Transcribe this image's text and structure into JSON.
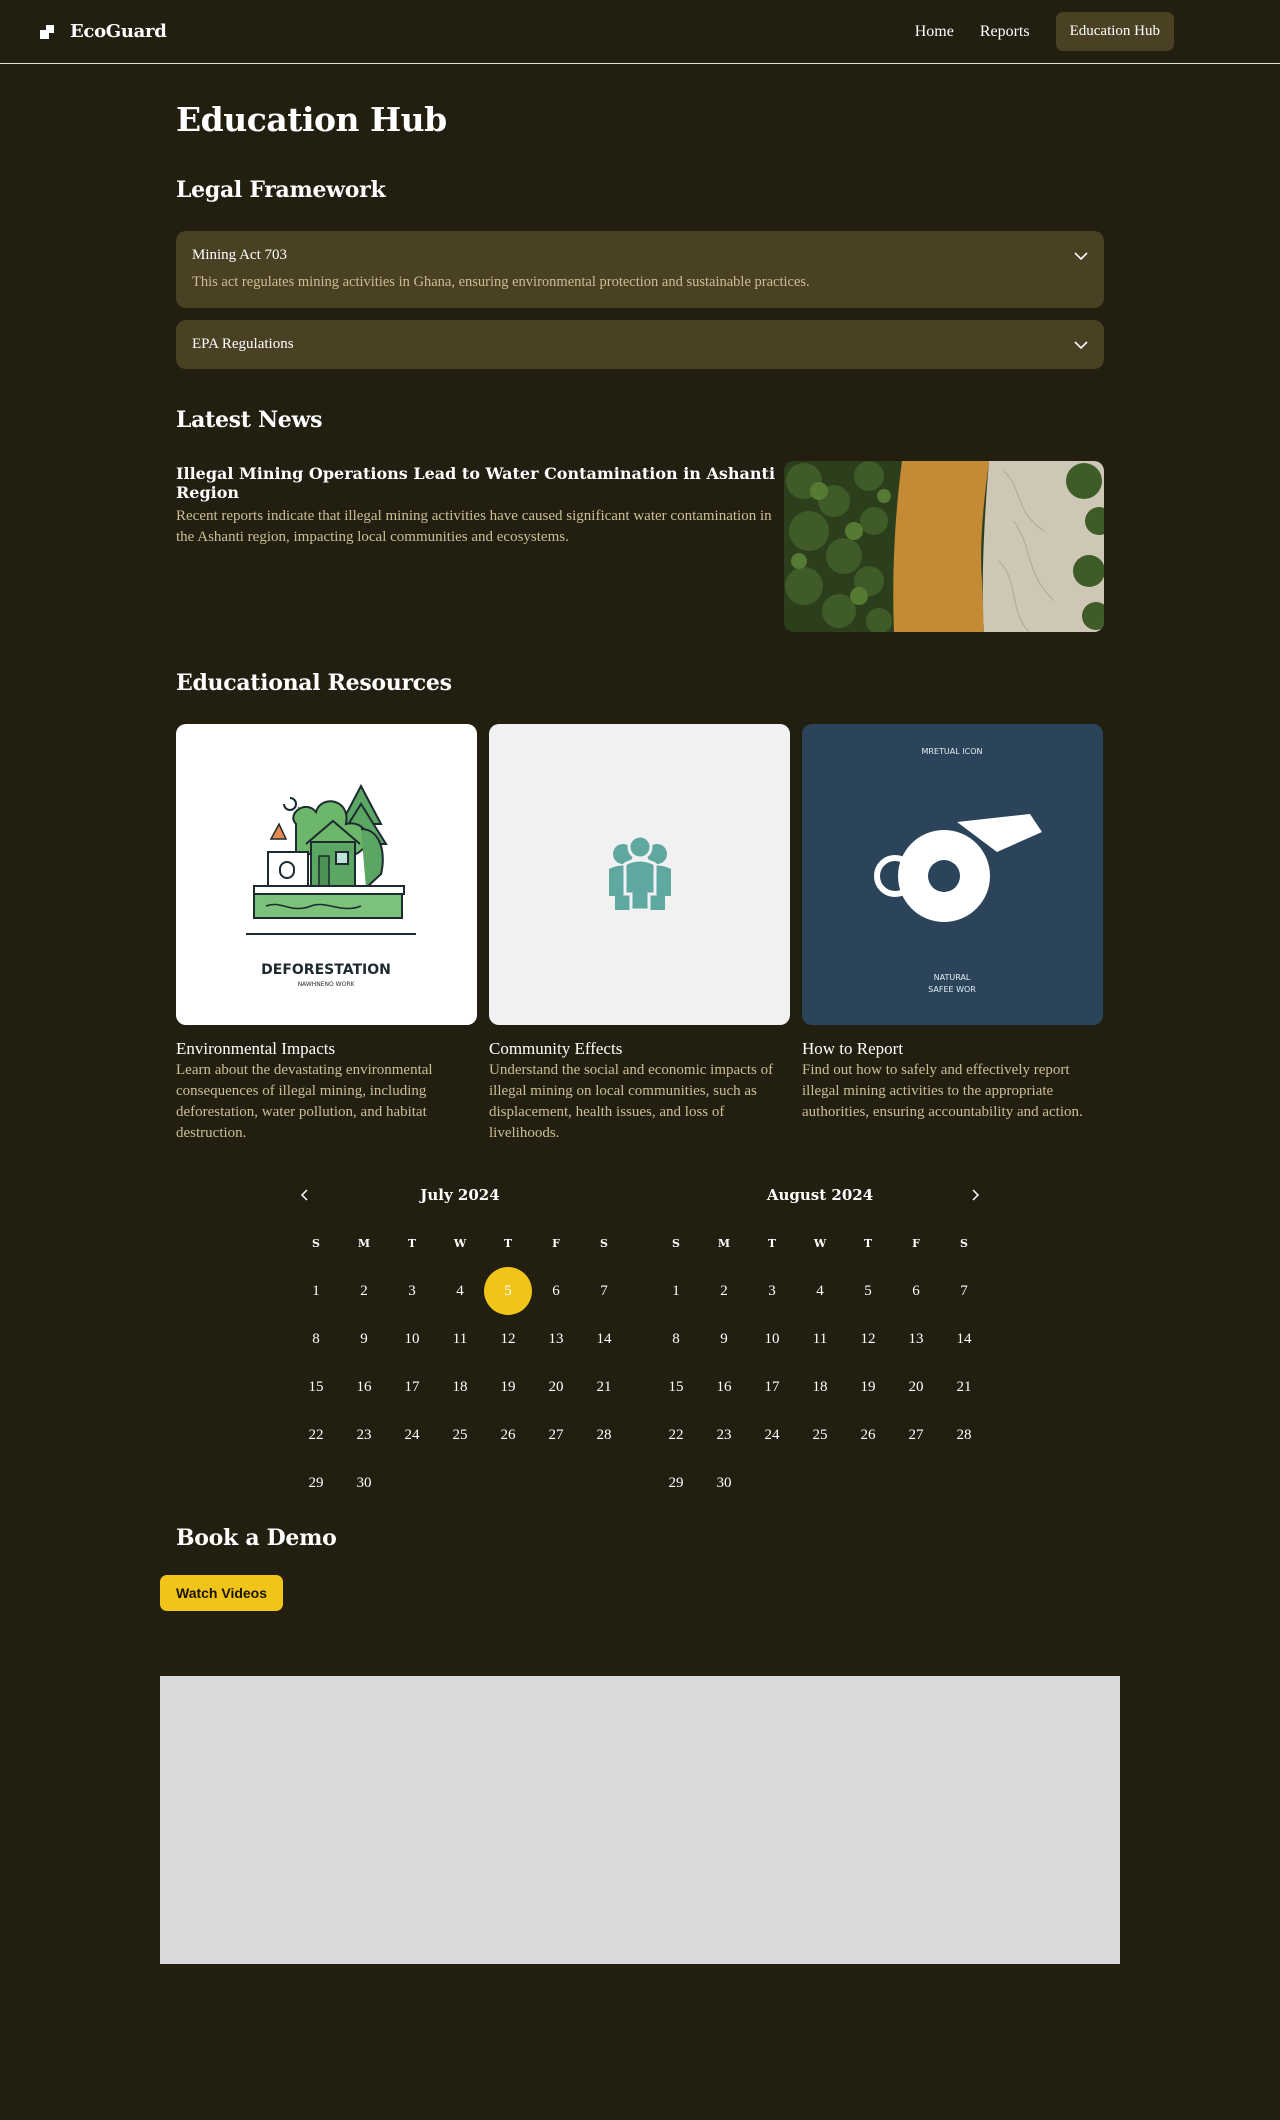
{
  "header": {
    "brand": "EcoGuard",
    "nav": {
      "home": "Home",
      "reports": "Reports",
      "hub": "Education Hub"
    }
  },
  "page_title": "Education Hub",
  "legal": {
    "title": "Legal Framework",
    "items": [
      {
        "title": "Mining Act 703",
        "body": "This act regulates mining activities in Ghana, ensuring environmental protection and sustainable practices.",
        "expanded": true
      },
      {
        "title": "EPA Regulations",
        "body": "",
        "expanded": false
      }
    ]
  },
  "news": {
    "title": "Latest News",
    "article": {
      "title": "Illegal Mining Operations Lead to Water Contamination in Ashanti Region",
      "body": "Recent reports indicate that illegal mining activities have caused significant water contamination in the Ashanti region, impacting local communities and ecosystems."
    }
  },
  "resources": {
    "title": "Educational Resources",
    "cards": [
      {
        "title": "Environmental Impacts",
        "body": "Learn about the devastating environmental consequences of illegal mining, including deforestation, water pollution, and habitat destruction.",
        "image_caption": "DEFORESTATION",
        "image_subcaption": "NAWHNENO WORK",
        "icon": "house-forest-illustration"
      },
      {
        "title": "Community Effects",
        "body": "Understand the social and economic impacts of illegal mining on local communities, such as displacement, health issues, and loss of livelihoods.",
        "icon": "people-group-icon"
      },
      {
        "title": "How to Report",
        "body": "Find out how to safely and effectively report illegal mining activities to the appropriate authorities, ensuring accountability and action.",
        "image_top": "MRETUAL ICON",
        "image_bottom1": "NATURAL",
        "image_bottom2": "SAFEE WOR",
        "icon": "whistle-icon"
      }
    ]
  },
  "calendar": {
    "weekdays": [
      "S",
      "M",
      "T",
      "W",
      "T",
      "F",
      "S"
    ],
    "months": [
      {
        "label": "July 2024",
        "days": [
          "1",
          "2",
          "3",
          "4",
          "5",
          "6",
          "7",
          "8",
          "9",
          "10",
          "11",
          "12",
          "13",
          "14",
          "15",
          "16",
          "17",
          "18",
          "19",
          "20",
          "21",
          "22",
          "23",
          "24",
          "25",
          "26",
          "27",
          "28",
          "29",
          "30"
        ],
        "selected": "5"
      },
      {
        "label": "August 2024",
        "days": [
          "1",
          "2",
          "3",
          "4",
          "5",
          "6",
          "7",
          "8",
          "9",
          "10",
          "11",
          "12",
          "13",
          "14",
          "15",
          "16",
          "17",
          "18",
          "19",
          "20",
          "21",
          "22",
          "23",
          "24",
          "25",
          "26",
          "27",
          "28",
          "29",
          "30"
        ]
      }
    ]
  },
  "demo": {
    "title": "Book a Demo",
    "button": "Watch Videos"
  },
  "colors": {
    "background": "#221f11",
    "panel": "#4a4023",
    "accent": "#f0c418",
    "muted_text": "#cdbe95"
  }
}
